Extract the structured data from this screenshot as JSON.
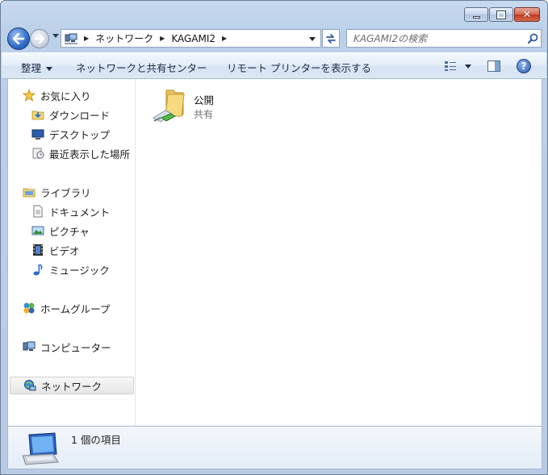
{
  "address": {
    "crumbs": [
      "ネットワーク",
      "KAGAMI2"
    ]
  },
  "search": {
    "placeholder": "KAGAMI2の検索"
  },
  "toolbar": {
    "organize": "整理",
    "network_sharing": "ネットワークと共有センター",
    "remote_printers": "リモート プリンターを表示する"
  },
  "nav": {
    "favorites": "お気に入り",
    "downloads": "ダウンロード",
    "desktop": "デスクトップ",
    "recent": "最近表示した場所",
    "libraries": "ライブラリ",
    "documents": "ドキュメント",
    "pictures": "ピクチャ",
    "videos": "ビデオ",
    "music": "ミュージック",
    "homegroup": "ホームグループ",
    "computer": "コンピューター",
    "network": "ネットワーク"
  },
  "files": [
    {
      "name": "公開",
      "type": "共有"
    }
  ],
  "details": {
    "count": "1 個の項目"
  },
  "colors": {
    "accent": "#2f6bc9",
    "selection": "#e6e6e6"
  },
  "icons": [
    "back-arrow-icon",
    "forward-arrow-icon",
    "network-icon",
    "refresh-icon",
    "search-icon",
    "view-icon",
    "preview-pane-icon",
    "help-icon",
    "star-icon",
    "folder-icon",
    "share-icon"
  ]
}
